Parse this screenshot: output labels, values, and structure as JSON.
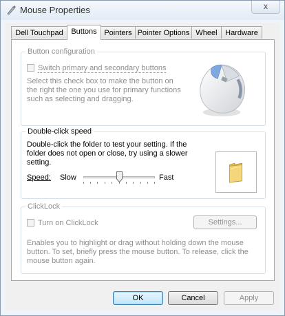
{
  "window": {
    "title": "Mouse Properties",
    "close_glyph": "x"
  },
  "tabs": [
    {
      "label": "Dell Touchpad",
      "active": false
    },
    {
      "label": "Buttons",
      "active": true
    },
    {
      "label": "Pointers",
      "active": false
    },
    {
      "label": "Pointer Options",
      "active": false
    },
    {
      "label": "Wheel",
      "active": false
    },
    {
      "label": "Hardware",
      "active": false
    }
  ],
  "button_config": {
    "title": "Button configuration",
    "checkbox_label": "Switch primary and secondary buttons",
    "checked": false,
    "description": "Select this check box to make the button on the right the one you use for primary functions such as selecting and dragging."
  },
  "double_click": {
    "title": "Double-click speed",
    "description": "Double-click the folder to test your setting. If the folder does not open or close, try using a slower setting.",
    "speed_label": "Speed:",
    "slow_label": "Slow",
    "fast_label": "Fast",
    "speed_level": 0.5
  },
  "clicklock": {
    "title": "ClickLock",
    "checkbox_label": "Turn on ClickLock",
    "checked": false,
    "settings_button": "Settings...",
    "description": "Enables you to highlight or drag without holding down the mouse button. To set, briefly press the mouse button. To release, click the mouse button again."
  },
  "footer": {
    "ok": "OK",
    "cancel": "Cancel",
    "apply": "Apply"
  },
  "colors": {
    "accent": "#3c7fb1",
    "disabled_text": "#8f8f8f"
  }
}
